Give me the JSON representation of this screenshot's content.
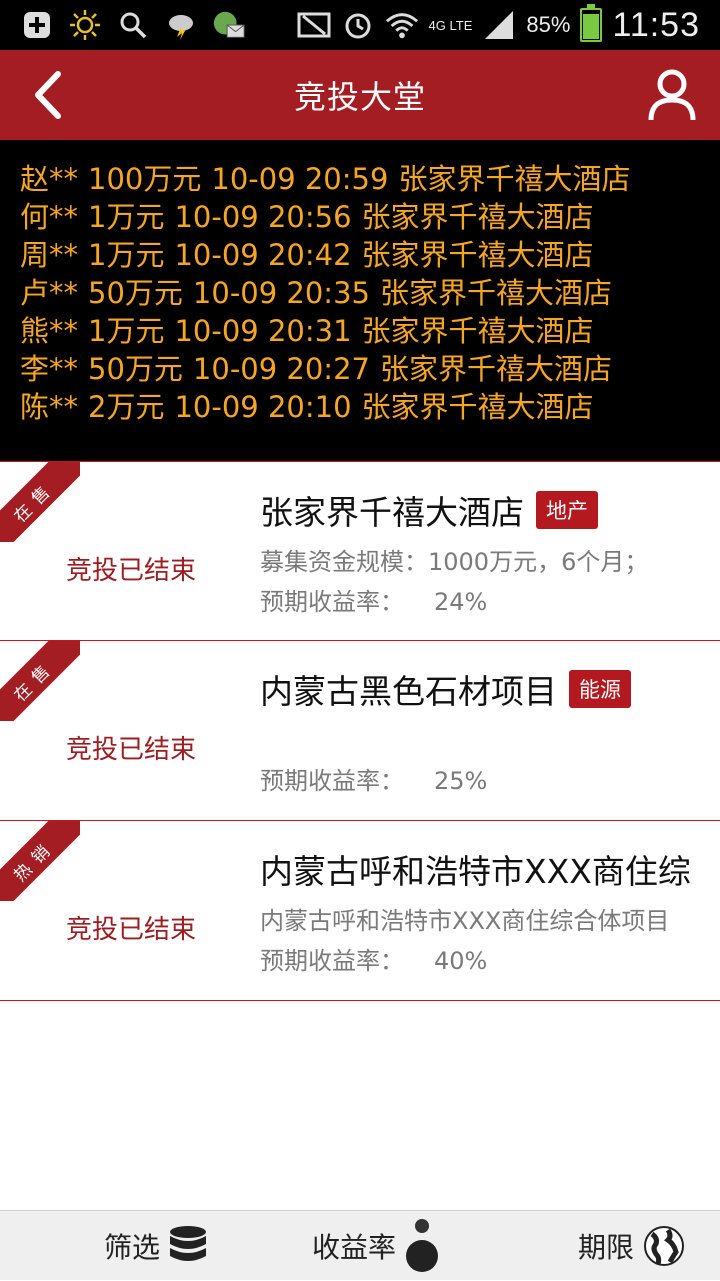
{
  "status_bar": {
    "network": "4G LTE",
    "battery": "85%",
    "battery_level": 0.85,
    "time": "11:53",
    "icons": [
      "add-icon",
      "brightness-icon",
      "search-icon",
      "weather-icon",
      "message-icon",
      "nfc-icon",
      "alarm-icon",
      "wifi-icon",
      "signal-icon",
      "battery-icon"
    ]
  },
  "header": {
    "title": "竞投大堂",
    "back_icon": "back-icon",
    "user_icon": "user-icon"
  },
  "ticker": [
    {
      "name": "赵**",
      "amount": "100万元",
      "time": "10-09 20:59",
      "project": "张家界千禧大酒店"
    },
    {
      "name": "何**",
      "amount": "1万元",
      "time": "10-09 20:56",
      "project": "张家界千禧大酒店"
    },
    {
      "name": "周**",
      "amount": "1万元",
      "time": "10-09 20:42",
      "project": "张家界千禧大酒店"
    },
    {
      "name": "卢**",
      "amount": "50万元",
      "time": "10-09 20:35",
      "project": "张家界千禧大酒店"
    },
    {
      "name": "熊**",
      "amount": "1万元",
      "time": "10-09 20:31",
      "project": "张家界千禧大酒店"
    },
    {
      "name": "李**",
      "amount": "50万元",
      "time": "10-09 20:27",
      "project": "张家界千禧大酒店"
    },
    {
      "name": "陈**",
      "amount": "2万元",
      "time": "10-09 20:10",
      "project": "张家界千禧大酒店"
    }
  ],
  "projects": [
    {
      "ribbon": "在售",
      "status": "竞投已结束",
      "title": "张家界千禧大酒店",
      "tag": "地产",
      "desc": "募集资金规模：1000万元，6个月；",
      "rate_label": "预期收益率：",
      "rate_value": "24%"
    },
    {
      "ribbon": "在售",
      "status": "竞投已结束",
      "title": "内蒙古黑色石材项目",
      "tag": "能源",
      "desc": "",
      "rate_label": "预期收益率：",
      "rate_value": "25%"
    },
    {
      "ribbon": "热销",
      "status": "竞投已结束",
      "title": "内蒙古呼和浩特市XXX商住综",
      "tag": "",
      "desc": "内蒙古呼和浩特市XXX商住综合体项目",
      "rate_label": "预期收益率：",
      "rate_value": "40%"
    }
  ],
  "bottom_tabs": {
    "filter": {
      "label": "筛选",
      "icon": "database-icon"
    },
    "rate": {
      "label": "收益率",
      "icon": "ball-icon"
    },
    "term": {
      "label": "期限",
      "icon": "globe-icon"
    }
  },
  "colors": {
    "brand": "#a31d22",
    "ticker_text": "#f5a623",
    "battery": "#7ac943"
  }
}
